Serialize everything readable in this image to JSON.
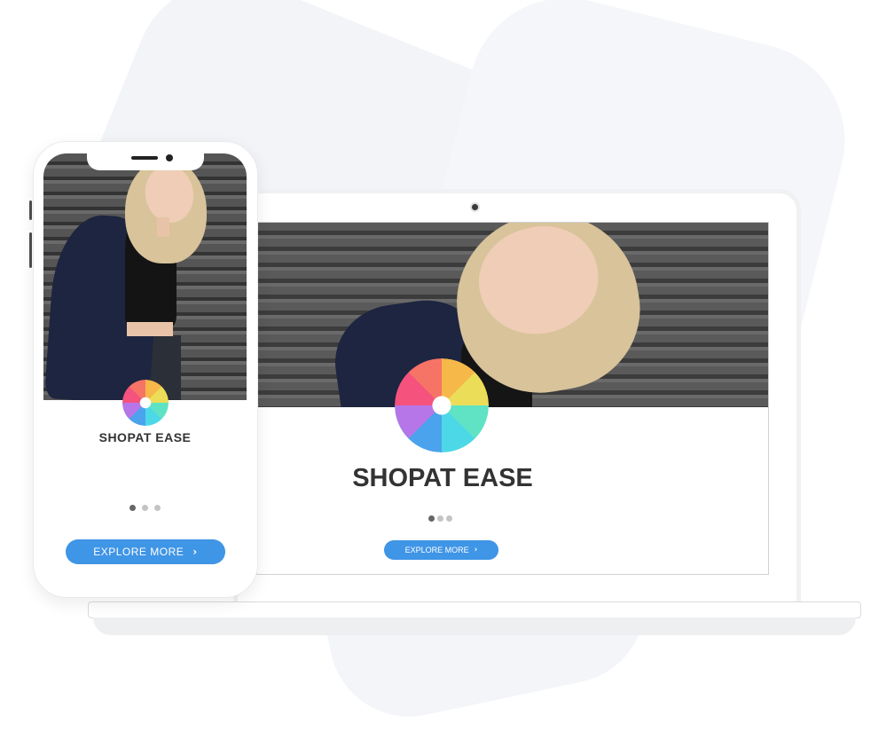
{
  "brand": {
    "name": "SHOPAT EASE",
    "accent_color": "#3f95e6",
    "logo_icon": "colorful-flower-logo-icon"
  },
  "laptop": {
    "hero_image": "model-smiling-photo",
    "title": "SHOPAT EASE",
    "carousel": {
      "count": 3,
      "active": 1
    },
    "cta": {
      "label": "EXPLORE MORE",
      "icon": "chevron-right-icon",
      "chevron": "›"
    }
  },
  "phone": {
    "hero_image": "model-walking-photo",
    "title": "SHOPAT EASE",
    "carousel": {
      "count": 3,
      "active": 1
    },
    "cta": {
      "label": "EXPLORE MORE",
      "icon": "chevron-right-icon",
      "chevron": "›"
    }
  }
}
